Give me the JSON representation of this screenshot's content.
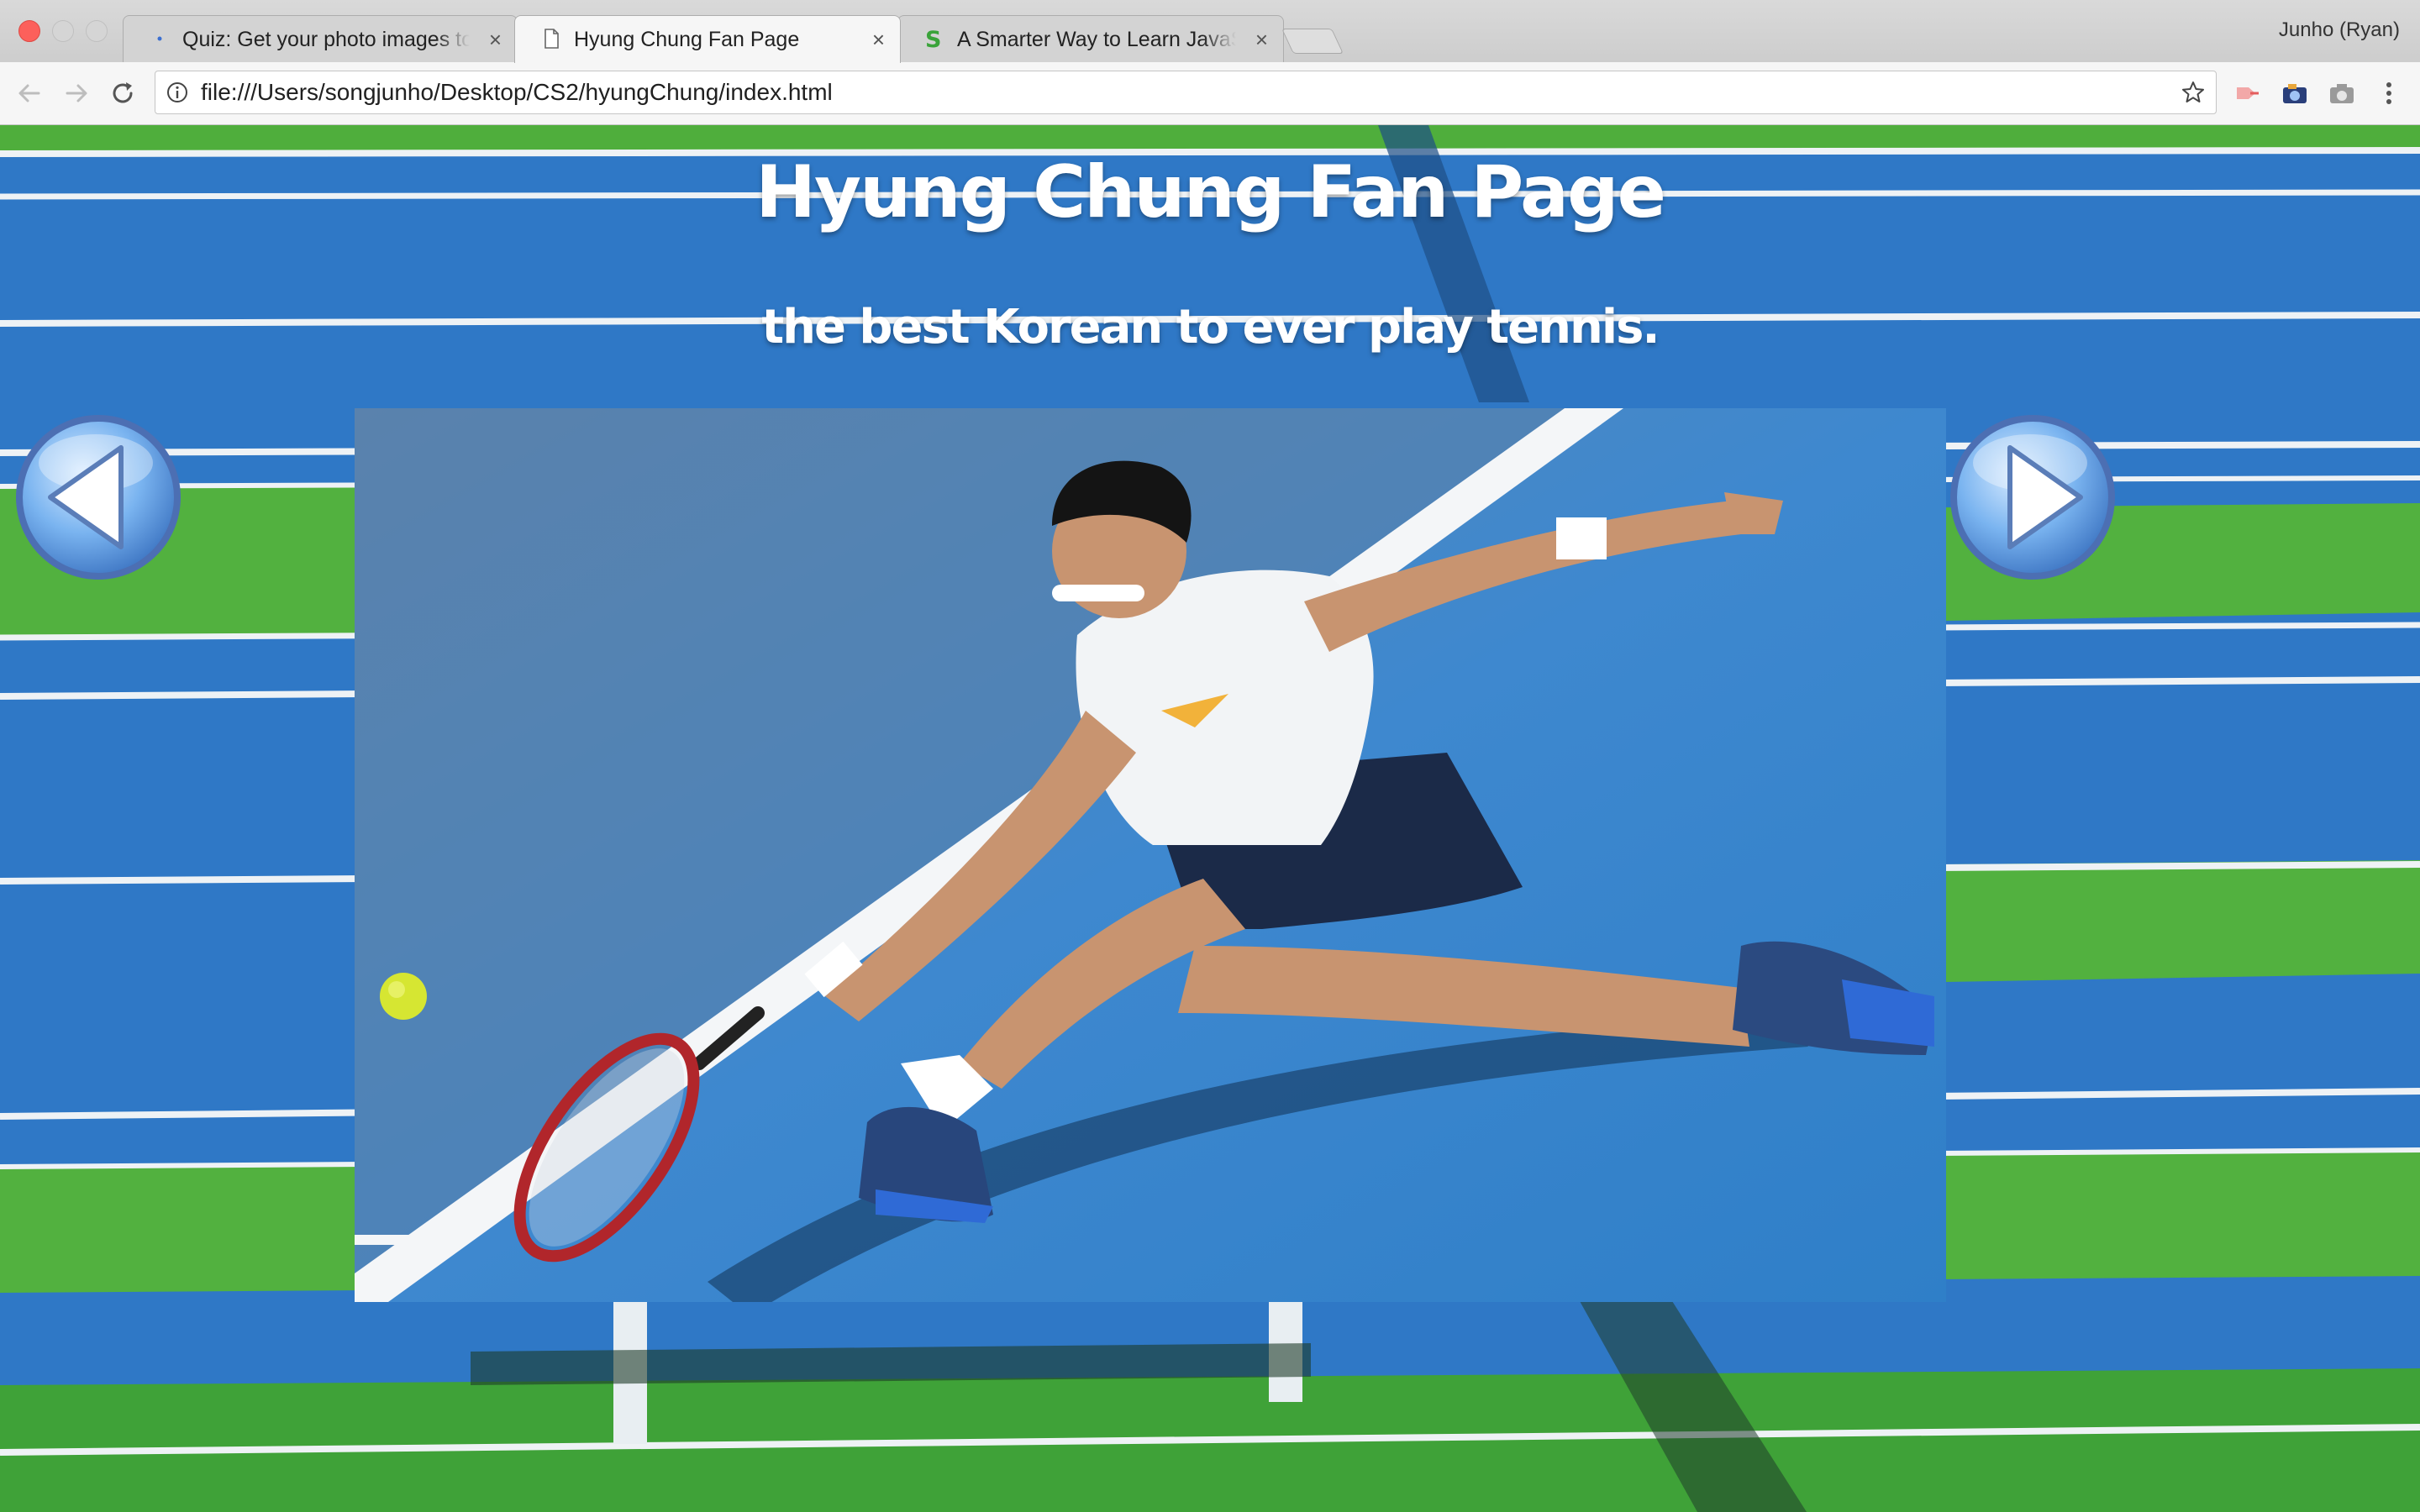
{
  "browser": {
    "tabs": [
      {
        "title": "Quiz: Get your photo images to",
        "icon": "loading-dot-icon",
        "active": false
      },
      {
        "title": "Hyung Chung Fan Page",
        "icon": "document-icon",
        "active": true
      },
      {
        "title": "A Smarter Way to Learn JavaScript",
        "icon": "letter-s-icon",
        "active": false
      }
    ],
    "tab_close_glyph": "×",
    "profile_name": "Junho (Ryan)",
    "url": "file:///Users/songjunho/Desktop/CS2/hyungChung/index.html"
  },
  "page": {
    "title": "Hyung Chung Fan Page",
    "subtitle": "the best Korean to ever play tennis.",
    "prev_button_icon": "left-arrow-icon",
    "next_button_icon": "right-arrow-icon",
    "image_description_visible": false
  },
  "colors": {
    "court_blue": "#2f78c6",
    "court_green": "#4fae3c",
    "button_blue": "#7ab4f0",
    "title_text": "#ffffff"
  }
}
